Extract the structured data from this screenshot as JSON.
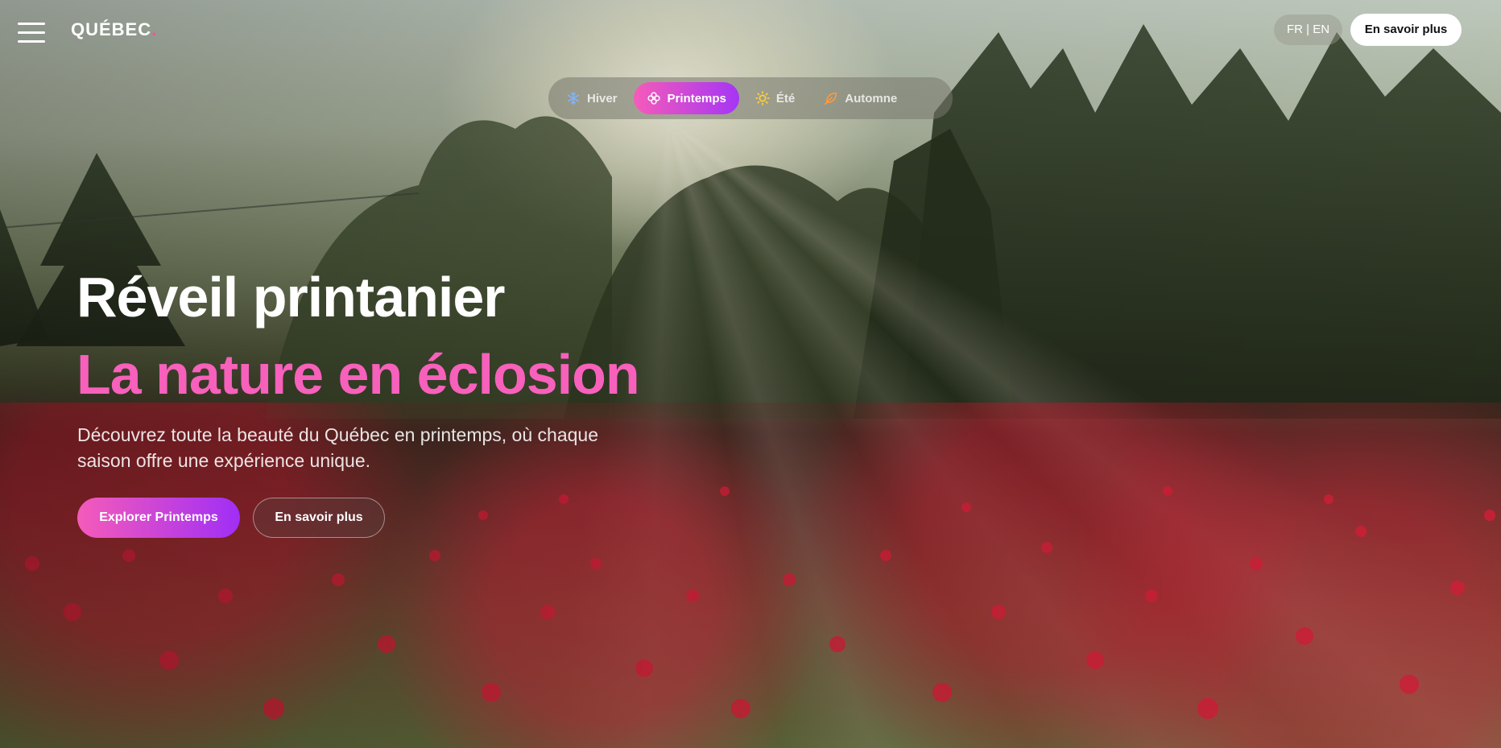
{
  "header": {
    "logo_text": "QUÉBEC",
    "logo_dot": ".",
    "lang_toggle": "FR | EN",
    "cta_label": "En savoir plus",
    "menu_icon": "hamburger-menu-icon"
  },
  "season_tabs": [
    {
      "label": "Hiver",
      "icon": "snowflake-icon",
      "icon_color": "#7fb4ff",
      "active": false
    },
    {
      "label": "Printemps",
      "icon": "flower-icon",
      "icon_color": "#ffffff",
      "active": true
    },
    {
      "label": "Été",
      "icon": "sun-icon",
      "icon_color": "#ffd23a",
      "active": false
    },
    {
      "label": "Automne",
      "icon": "leaf-icon",
      "icon_color": "#ff9a3c",
      "active": false
    }
  ],
  "hero": {
    "title": "Réveil printanier",
    "subtitle": "La nature en éclosion",
    "description": "Découvrez toute la beauté du Québec en printemps, où chaque saison offre une expérience unique.",
    "primary_cta": "Explorer Printemps",
    "secondary_cta": "En savoir plus"
  },
  "colors": {
    "accent_pink": "#f760bb",
    "gradient_start": "#f55bb9",
    "gradient_end": "#a536f5"
  }
}
